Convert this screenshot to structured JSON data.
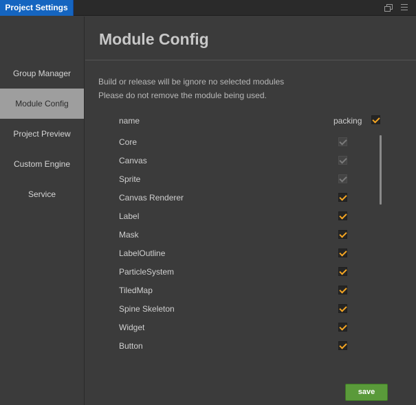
{
  "window": {
    "tab_title": "Project Settings",
    "restore_icon": "restore-window-icon",
    "menu_icon": "hamburger-menu-icon"
  },
  "sidebar": {
    "items": [
      {
        "label": "Group Manager",
        "active": false
      },
      {
        "label": "Module Config",
        "active": true
      },
      {
        "label": "Project Preview",
        "active": false
      },
      {
        "label": "Custom Engine",
        "active": false
      },
      {
        "label": "Service",
        "active": false
      }
    ]
  },
  "main": {
    "title": "Module Config",
    "description_line1": "Build or release will be ignore no selected modules",
    "description_line2": "Please do not remove the module being used.",
    "header_name": "name",
    "header_packing": "packing",
    "header_packing_checked": true,
    "modules": [
      {
        "name": "Core",
        "checked": true,
        "disabled": true
      },
      {
        "name": "Canvas",
        "checked": true,
        "disabled": true
      },
      {
        "name": "Sprite",
        "checked": true,
        "disabled": true
      },
      {
        "name": "Canvas Renderer",
        "checked": true,
        "disabled": false
      },
      {
        "name": "Label",
        "checked": true,
        "disabled": false
      },
      {
        "name": "Mask",
        "checked": true,
        "disabled": false
      },
      {
        "name": "LabelOutline",
        "checked": true,
        "disabled": false
      },
      {
        "name": "ParticleSystem",
        "checked": true,
        "disabled": false
      },
      {
        "name": "TiledMap",
        "checked": true,
        "disabled": false
      },
      {
        "name": "Spine Skeleton",
        "checked": true,
        "disabled": false
      },
      {
        "name": "Widget",
        "checked": true,
        "disabled": false
      },
      {
        "name": "Button",
        "checked": true,
        "disabled": false
      }
    ],
    "save_label": "save"
  },
  "colors": {
    "tab_active": "#1565c0",
    "checkmark": "#f5a623",
    "save_button": "#5a9a3a",
    "sidebar_active": "#9e9e9e"
  }
}
